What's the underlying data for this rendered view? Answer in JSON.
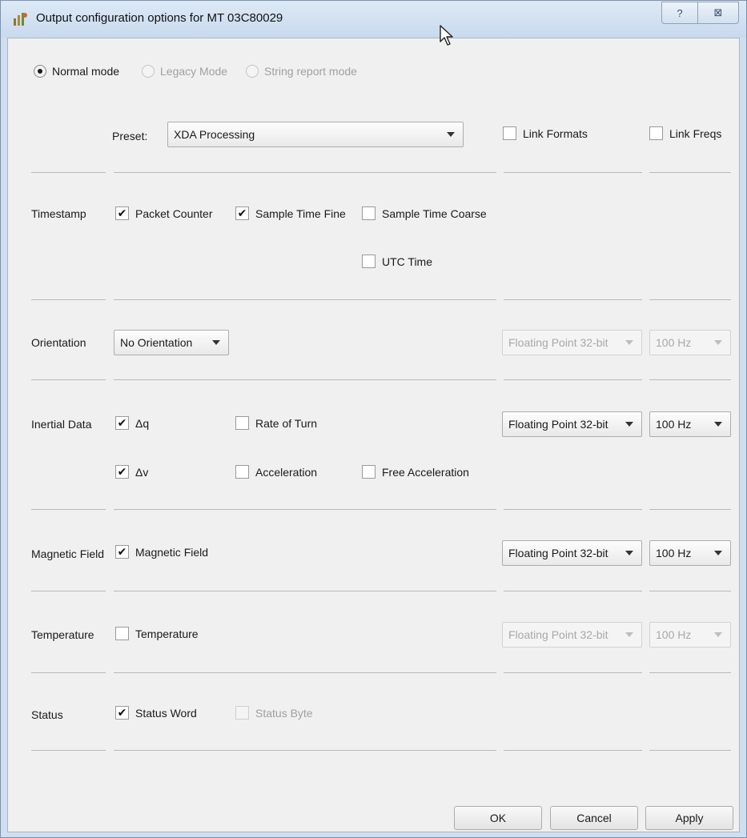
{
  "window": {
    "title": "Output configuration options for MT 03C80029",
    "help_glyph": "?",
    "close_glyph": "⊠"
  },
  "mode": {
    "normal": "Normal mode",
    "legacy": "Legacy Mode",
    "string_report": "String report mode",
    "selected": "normal"
  },
  "preset": {
    "label": "Preset:",
    "value": "XDA Processing",
    "link_formats": "Link Formats",
    "link_freqs": "Link Freqs"
  },
  "timestamp": {
    "label": "Timestamp",
    "packet_counter": "Packet Counter",
    "sample_time_fine": "Sample Time Fine",
    "sample_time_coarse": "Sample Time Coarse",
    "utc_time": "UTC Time"
  },
  "orientation": {
    "label": "Orientation",
    "value": "No Orientation",
    "format": "Floating Point 32-bit",
    "freq": "100 Hz"
  },
  "inertial": {
    "label": "Inertial Data",
    "dq": "Δq",
    "dv": "Δv",
    "rate_of_turn": "Rate of Turn",
    "acceleration": "Acceleration",
    "free_acceleration": "Free Acceleration",
    "format": "Floating Point 32-bit",
    "freq": "100 Hz"
  },
  "magnetic": {
    "label": "Magnetic Field",
    "checkbox": "Magnetic Field",
    "format": "Floating Point 32-bit",
    "freq": "100 Hz"
  },
  "temperature": {
    "label": "Temperature",
    "checkbox": "Temperature",
    "format": "Floating Point 32-bit",
    "freq": "100 Hz"
  },
  "status": {
    "label": "Status",
    "status_word": "Status Word",
    "status_byte": "Status Byte"
  },
  "check_glyph": "✔",
  "buttons": {
    "ok": "OK",
    "cancel": "Cancel",
    "apply": "Apply"
  }
}
